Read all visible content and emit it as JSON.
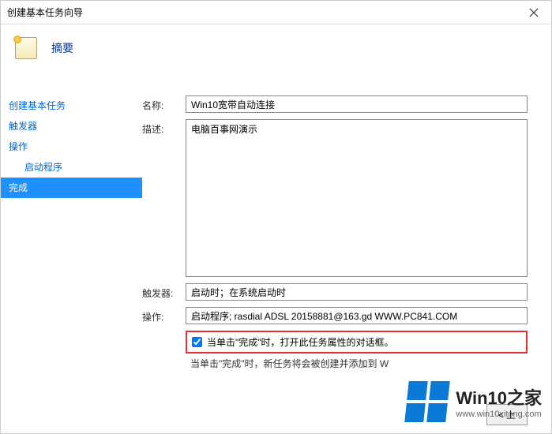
{
  "window": {
    "title": "创建基本任务向导"
  },
  "header": {
    "title": "摘要"
  },
  "sidebar": {
    "items": [
      {
        "label": "创建基本任务"
      },
      {
        "label": "触发器"
      },
      {
        "label": "操作"
      },
      {
        "label": "启动程序"
      },
      {
        "label": "完成"
      }
    ]
  },
  "form": {
    "name_label": "名称:",
    "name_value": "Win10宽带自动连接",
    "desc_label": "描述:",
    "desc_value": "电脑百事网演示",
    "trigger_label": "触发器:",
    "trigger_value": "启动时；在系统启动时",
    "action_label": "操作:",
    "action_value": "启动程序; rasdial ADSL 20158881@163.gd WWW.PC841.COM",
    "checkbox_label": "当单击\"完成\"时，打开此任务属性的对话框。",
    "note_text": "当单击\"完成\"时，新任务将会被创建并添加到 W"
  },
  "buttons": {
    "back": "< 上"
  },
  "watermark": {
    "brand": "Win10",
    "suffix": "之家",
    "url": "www.win10xitong.com"
  }
}
